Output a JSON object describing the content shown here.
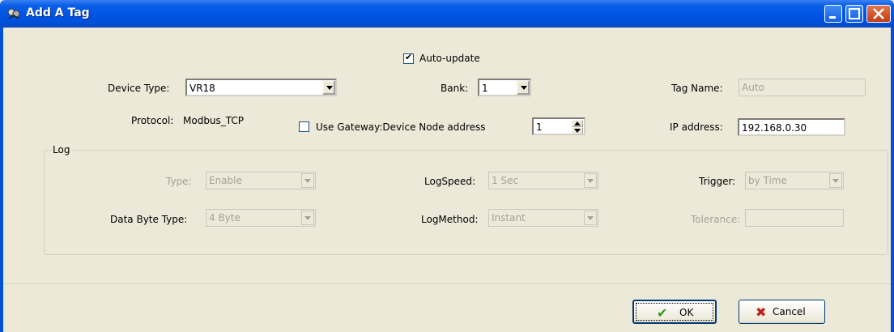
{
  "window": {
    "title": "Add A Tag"
  },
  "auto_update": {
    "label": "Auto-update",
    "checked": true
  },
  "device_type": {
    "label": "Device Type:",
    "value": "VR18"
  },
  "bank": {
    "label": "Bank:",
    "value": "1"
  },
  "tag_name": {
    "label": "Tag Name:",
    "value": "Auto"
  },
  "protocol": {
    "label": "Protocol:",
    "value": "Modbus_TCP"
  },
  "gateway": {
    "label": "Use Gateway:Device Node address",
    "checked": false,
    "node_address": "1"
  },
  "ip_address": {
    "label": "IP address:",
    "value": "192.168.0.30"
  },
  "log": {
    "title": "Log",
    "type": {
      "label": "Type:",
      "value": "Enable"
    },
    "log_speed": {
      "label": "LogSpeed:",
      "value": "1 Sec"
    },
    "trigger": {
      "label": "Trigger:",
      "value": "by Time"
    },
    "data_byte_type": {
      "label": "Data Byte Type:",
      "value": "4 Byte"
    },
    "log_method": {
      "label": "LogMethod:",
      "value": "Instant"
    },
    "tolerance": {
      "label": "Tolerance:",
      "value": ""
    }
  },
  "buttons": {
    "ok": "OK",
    "cancel": "Cancel"
  },
  "icons": {
    "ok_icon": "✔",
    "cancel_icon": "✖"
  },
  "colors": {
    "title_bar": "#0050d8",
    "dialog_bg": "#ece9d8",
    "ok_green": "#2e9a17",
    "cancel_red": "#c0201a"
  }
}
